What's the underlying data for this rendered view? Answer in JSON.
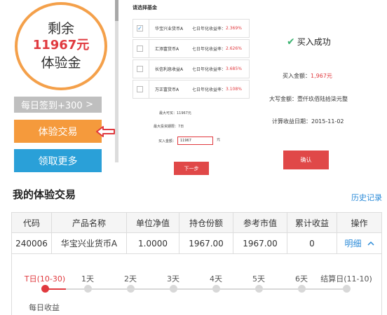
{
  "balance": {
    "line1": "剩余",
    "amount": "11967元",
    "line3": "体验金"
  },
  "left_panel": {
    "checkin_label": "每日签到+300",
    "checkin_arrow": ">",
    "trade_button": "体验交易",
    "get_more_button": "领取更多",
    "arrow_icon": "left-arrow-icon"
  },
  "fund_select": {
    "title": "请选择基金",
    "rate_label": "七日年化收益率：",
    "funds": [
      {
        "name": "华宝兴业货币A",
        "rate": "2.369%",
        "checked": true,
        "check_mark": "✓"
      },
      {
        "name": "汇添富货币A",
        "rate": "2.626%",
        "checked": false,
        "check_mark": ""
      },
      {
        "name": "长信利息收益A",
        "rate": "3.685%",
        "checked": false,
        "check_mark": ""
      },
      {
        "name": "万正富货币A",
        "rate": "3.108%",
        "checked": false,
        "check_mark": ""
      }
    ],
    "max_buy": "最大可买：11967元",
    "max_hold": "最大投资期限：7日",
    "buy_amount_label": "买入金额：",
    "buy_amount_value": "11967",
    "unit": "元",
    "next_button": "下一步"
  },
  "result": {
    "success_text": "买入成功",
    "amount_label": "买入金额：",
    "amount_value": "1,967元",
    "upper_label": "大写金额：",
    "upper_value": "壹仟玖佰陆拾柒元整",
    "date_label": "计算收益日期：",
    "date_value": "2015-11-02",
    "confirm_button": "确认"
  },
  "section": {
    "title": "我的体验交易",
    "history_link": "历史记录",
    "headers": [
      "代码",
      "产品名称",
      "单位净值",
      "持仓份额",
      "参考市值",
      "累计收益",
      "操作"
    ],
    "row": {
      "code": "240006",
      "name": "华宝兴业货币A",
      "nav": "1.0000",
      "shares": "1967.00",
      "market_value": "1967.00",
      "profit": "0",
      "action": "明细",
      "action_icon": "chevron-up-icon"
    }
  },
  "timeline": {
    "labels": [
      "T日(10-30)",
      "1天",
      "2天",
      "3天",
      "4天",
      "5天",
      "6天",
      "结算日(11-10)"
    ],
    "progress_index": 0,
    "daily_label": "每日收益",
    "active_color": "#e0393e"
  }
}
